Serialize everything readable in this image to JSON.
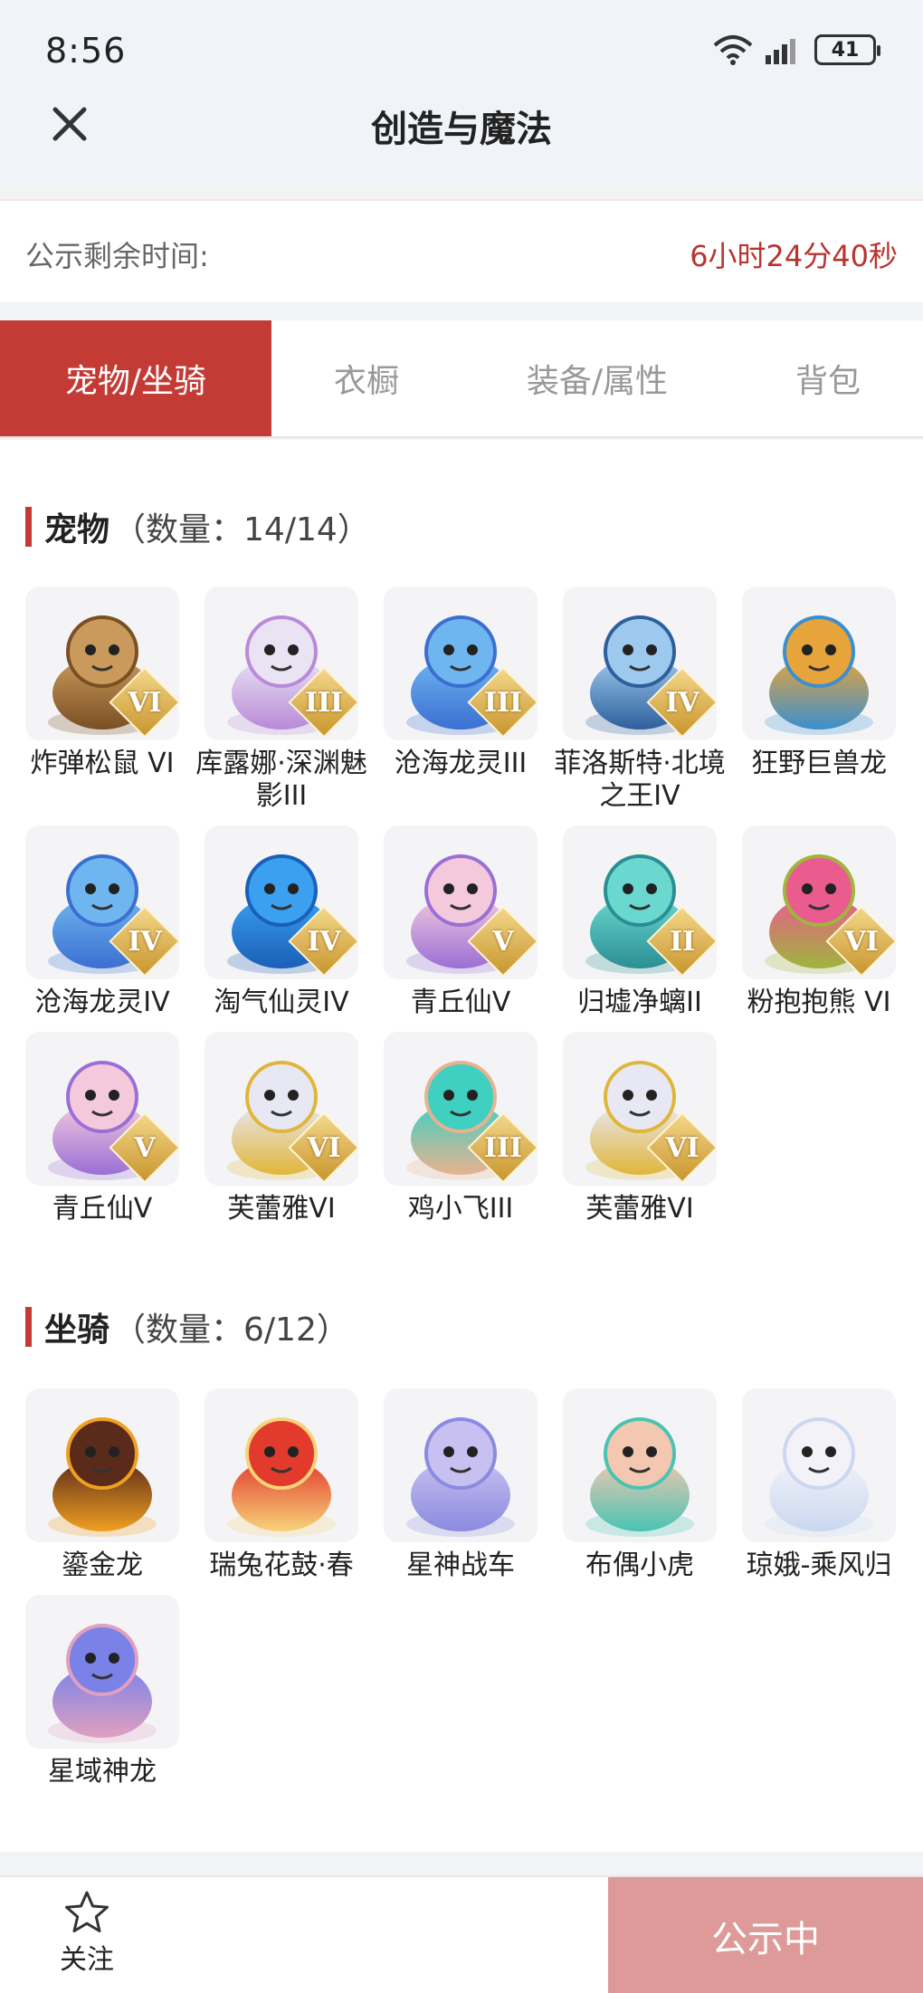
{
  "status_bar": {
    "time": "8:56",
    "battery": "41"
  },
  "header": {
    "title": "创造与魔法"
  },
  "countdown": {
    "label": "公示剩余时间:",
    "value": "6小时24分40秒"
  },
  "tabs": [
    {
      "label": "宠物/坐骑",
      "active": true
    },
    {
      "label": "衣橱",
      "active": false
    },
    {
      "label": "装备/属性",
      "active": false
    },
    {
      "label": "背包",
      "active": false
    }
  ],
  "pets": {
    "title": "宠物",
    "count": "（数量：14/14）",
    "items": [
      {
        "name": "炸弹松鼠 VI",
        "rank": "VI",
        "icon": "squirrel-icon"
      },
      {
        "name": "库露娜·深渊魅影III",
        "rank": "III",
        "icon": "ghost-girl-icon"
      },
      {
        "name": "沧海龙灵III",
        "rank": "III",
        "icon": "dragon-spirit-icon"
      },
      {
        "name": "菲洛斯特·北境之王IV",
        "rank": "IV",
        "icon": "ice-king-icon"
      },
      {
        "name": "狂野巨兽龙",
        "rank": "",
        "icon": "wild-dragon-icon"
      },
      {
        "name": "沧海龙灵IV",
        "rank": "IV",
        "icon": "dragon-spirit-icon"
      },
      {
        "name": "淘气仙灵IV",
        "rank": "IV",
        "icon": "blue-dog-icon"
      },
      {
        "name": "青丘仙V",
        "rank": "V",
        "icon": "fox-fairy-icon"
      },
      {
        "name": "归墟净螭II",
        "rank": "II",
        "icon": "jade-dragon-icon"
      },
      {
        "name": "粉抱抱熊 VI",
        "rank": "VI",
        "icon": "pink-bear-icon"
      },
      {
        "name": "青丘仙V",
        "rank": "V",
        "icon": "fox-fairy-icon"
      },
      {
        "name": "芙蕾雅VI",
        "rank": "VI",
        "icon": "valkyrie-icon"
      },
      {
        "name": "鸡小飞III",
        "rank": "III",
        "icon": "chick-icon"
      },
      {
        "name": "芙蕾雅VI",
        "rank": "VI",
        "icon": "valkyrie-icon"
      }
    ]
  },
  "mounts": {
    "title": "坐骑",
    "count": "（数量：6/12）",
    "items": [
      {
        "name": "鎏金龙",
        "icon": "gold-dragon-icon"
      },
      {
        "name": "瑞兔花鼓·春",
        "icon": "rabbit-drum-icon"
      },
      {
        "name": "星神战车",
        "icon": "star-chariot-icon"
      },
      {
        "name": "布偶小虎",
        "icon": "toy-tiger-icon"
      },
      {
        "name": "琼娥-乘风归",
        "icon": "moon-lady-icon"
      },
      {
        "name": "星域神龙",
        "icon": "star-dragon-icon"
      }
    ]
  },
  "footer": {
    "follow_label": "关注",
    "status_label": "公示中"
  },
  "colors": {
    "accent": "#c43a34",
    "timer": "#b8342e",
    "status_button": "#dd9a98"
  }
}
